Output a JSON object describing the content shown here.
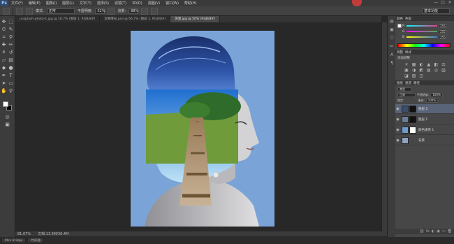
{
  "app": {
    "logo": "Ps",
    "menus": [
      "文件(F)",
      "编辑(E)",
      "图像(I)",
      "图层(L)",
      "文字(Y)",
      "选择(S)",
      "滤镜(T)",
      "3D(D)",
      "视图(V)",
      "窗口(W)",
      "帮助(H)"
    ],
    "window_controls": [
      "—",
      "□",
      "×"
    ]
  },
  "options": {
    "mode_label": "模式:",
    "mode_value": "正常",
    "opacity_label": "不透明度:",
    "opacity_value": "52%",
    "flow_label": "流量:",
    "flow_value": "88%",
    "workspace": "基本功能"
  },
  "documents": {
    "tabs": [
      "unsplash-photo-1.jpg @ 16.7% (图层 1, RGB/8#)",
      "双重曝光.psd @ 66.7% (图层 1, RGB/8#)",
      "风景.jpg @ 50% (RGB/8#)"
    ],
    "active_index": 1
  },
  "status": {
    "zoom": "81.67%",
    "doc_size": "文档:13.5M/36.4M"
  },
  "bottom_tabs": [
    "Mini Bridge",
    "时间轴"
  ],
  "panels": {
    "color_tabs": [
      "颜色",
      "色板"
    ],
    "color_sliders": [
      {
        "label": "R",
        "value": "255",
        "color": "#e63c8c"
      },
      {
        "label": "G",
        "value": "255",
        "color": "#4caf50"
      },
      {
        "label": "B",
        "value": "255",
        "color": "#3f7de0"
      }
    ],
    "adjust_tabs": [
      "调整",
      "样式"
    ],
    "adjust_title": "添加调整",
    "adjust_icons": [
      "☀",
      "▦",
      "◐",
      "▲",
      "◧",
      "⚖",
      "▣",
      "◑",
      "◩",
      "▤",
      "◎",
      "▥",
      "◪",
      "▧",
      "◫"
    ],
    "layers_tabs": [
      "图层",
      "通道",
      "路径"
    ],
    "kind_label": "类型",
    "blend_mode": "正常",
    "opacity_label": "不透明度:",
    "opacity_value": "100%",
    "lock_label": "锁定:",
    "fill_label": "填充:",
    "fill_value": "100%",
    "layers": [
      {
        "name": "图层 2",
        "thumb": "#3a4d6b",
        "mask": true,
        "active": true
      },
      {
        "name": "图层 1",
        "thumb": "#6a7e95",
        "mask": true,
        "active": false
      },
      {
        "name": "颜色填充 1",
        "thumb": "#6f9bd2",
        "mask": true,
        "active": false
      },
      {
        "name": "背景",
        "thumb": "#8da4c2",
        "mask": false,
        "active": false
      }
    ],
    "footer_icons": [
      "⛓",
      "fx",
      "◐",
      "▣",
      "▭",
      "🗑"
    ]
  }
}
